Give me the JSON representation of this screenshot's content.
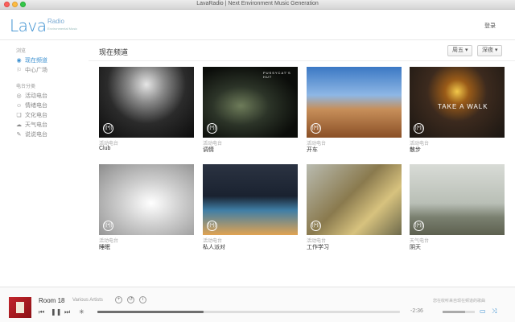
{
  "window": {
    "title": "LavaRadio | Next Environment Music Generation"
  },
  "header": {
    "logo_main": "Lava",
    "logo_sub": "Radio",
    "logo_tag": "Environmental Music",
    "login": "登录"
  },
  "sidebar": {
    "section1": "浏览",
    "nav": [
      {
        "label": "现在频道",
        "active": true,
        "icon": "radio-icon"
      },
      {
        "label": "中心广场",
        "icon": "flag-icon"
      }
    ],
    "section2": "电台分类",
    "categories": [
      {
        "label": "活动电台",
        "icon": "activity-icon"
      },
      {
        "label": "情绪电台",
        "icon": "mood-icon"
      },
      {
        "label": "文化电台",
        "icon": "culture-icon"
      },
      {
        "label": "天气电台",
        "icon": "weather-icon"
      },
      {
        "label": "说说电台",
        "icon": "talk-icon"
      }
    ]
  },
  "main": {
    "title": "现在频道",
    "day_dropdown": "周五 ▾",
    "time_dropdown": "深夜 ▾",
    "cards": [
      {
        "category": "活动电台",
        "name": "Club",
        "overlay": "",
        "bg": "club"
      },
      {
        "category": "活动电台",
        "name": "调情",
        "overlay": "PUSSYCAT'S HUT",
        "bg": "dark"
      },
      {
        "category": "活动电台",
        "name": "开车",
        "overlay": "",
        "bg": "car"
      },
      {
        "category": "活动电台",
        "name": "散步",
        "overlay": "TAKE A WALK",
        "bg": "walk"
      },
      {
        "category": "活动电台",
        "name": "睡眠",
        "overlay": "",
        "bg": "sleep"
      },
      {
        "category": "活动电台",
        "name": "私人派对",
        "overlay": "",
        "bg": "party"
      },
      {
        "category": "活动电台",
        "name": "工作学习",
        "overlay": "",
        "bg": "pen"
      },
      {
        "category": "天气电台",
        "name": "阴天",
        "overlay": "",
        "bg": "cloudy"
      }
    ]
  },
  "player": {
    "track": "Room 18",
    "artist": "Various Artists",
    "time": "-2:36",
    "status": "您在收听来自现在频道的歌曲",
    "progress": 0.35,
    "volume": 0.7
  },
  "colors": {
    "accent": "#3a8fd0"
  }
}
